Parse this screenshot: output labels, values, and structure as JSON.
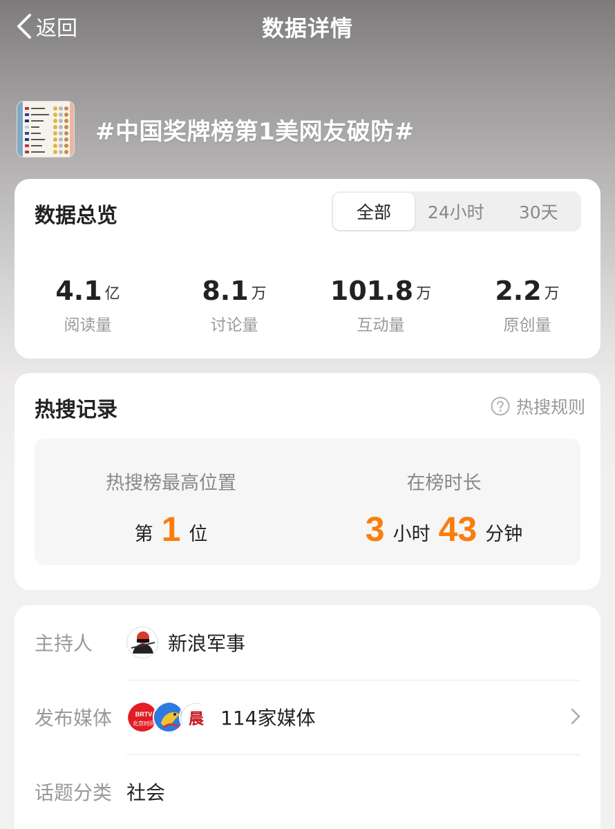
{
  "nav": {
    "back_label": "返回",
    "title": "数据详情"
  },
  "topic": {
    "title": "#中国奖牌榜第1美网友破防#"
  },
  "overview": {
    "heading": "数据总览",
    "tabs": [
      "全部",
      "24小时",
      "30天"
    ],
    "active_tab": "全部",
    "stats": [
      {
        "value": "4.1",
        "unit": "亿",
        "label": "阅读量"
      },
      {
        "value": "8.1",
        "unit": "万",
        "label": "讨论量"
      },
      {
        "value": "101.8",
        "unit": "万",
        "label": "互动量"
      },
      {
        "value": "2.2",
        "unit": "万",
        "label": "原创量"
      }
    ]
  },
  "hot": {
    "heading": "热搜记录",
    "rules_label": "热搜规则",
    "peak": {
      "label": "热搜榜最高位置",
      "prefix": "第",
      "rank": "1",
      "suffix": "位"
    },
    "duration": {
      "label": "在榜时长",
      "hours": "3",
      "hours_unit": "小时",
      "minutes": "43",
      "minutes_unit": "分钟"
    }
  },
  "info": {
    "host": {
      "label": "主持人",
      "name": "新浪军事"
    },
    "media": {
      "label": "发布媒体",
      "count_text": "114家媒体",
      "logo_texts": [
        "BRTV",
        "北京时间",
        "晨"
      ]
    },
    "category": {
      "label": "话题分类",
      "value": "社会"
    }
  },
  "colors": {
    "accent": "#fb7d0b",
    "muted": "#999999"
  }
}
